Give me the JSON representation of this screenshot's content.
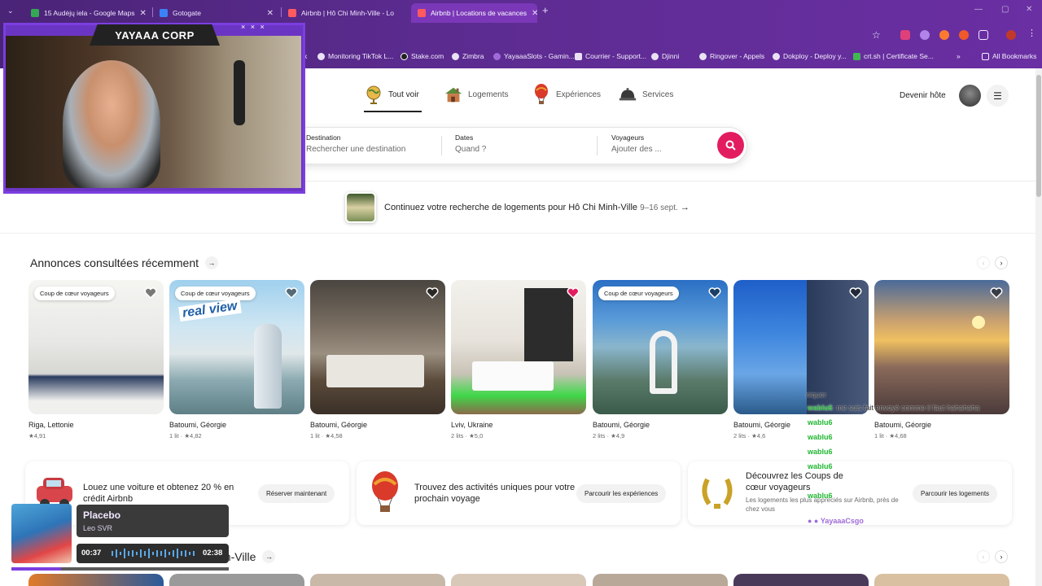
{
  "browser": {
    "tabs": [
      {
        "title": "15 Audėjų iela - Google Maps",
        "active": false
      },
      {
        "title": "Gotogate",
        "active": false
      },
      {
        "title": "Airbnb | Hô Chi Minh-Ville - Lo",
        "active": false
      },
      {
        "title": "Airbnb | Locations de vacances",
        "active": true
      }
    ],
    "bookmarks": [
      {
        "label": "Monitoring TikTok L..."
      },
      {
        "label": "Stake.com"
      },
      {
        "label": "Zimbra"
      },
      {
        "label": "YayaaaSlots - Gamin..."
      },
      {
        "label": "Courrier - Support..."
      },
      {
        "label": "Djinni"
      },
      {
        "label": "Ringover - Appels"
      },
      {
        "label": "Dokploy - Deploy y..."
      },
      {
        "label": "crt.sh | Certificate Se..."
      },
      {
        "label": "All Bookmarks"
      }
    ],
    "bookmarks_prefix": "k",
    "bookmarks_more": "»"
  },
  "header": {
    "categories": [
      {
        "label": "Tout voir",
        "icon": "globe-icon",
        "selected": true
      },
      {
        "label": "Logements",
        "icon": "house-icon",
        "selected": false
      },
      {
        "label": "Expériences",
        "icon": "balloon-icon",
        "selected": false
      },
      {
        "label": "Services",
        "icon": "bell-icon",
        "selected": false
      }
    ],
    "host_label": "Devenir hôte"
  },
  "search": {
    "destination": {
      "label": "Destination",
      "placeholder": "Rechercher une destination"
    },
    "dates": {
      "label": "Dates",
      "placeholder": "Quand ?"
    },
    "guests": {
      "label": "Voyageurs",
      "placeholder": "Ajouter des ..."
    }
  },
  "continue_search": {
    "text": "Continuez votre recherche de logements pour Hô Chi Minh-Ville",
    "dates": "9–16 sept.",
    "arrow": "→"
  },
  "recent": {
    "title": "Annonces consultées récemment",
    "arrow": "→",
    "listings": [
      {
        "badge": "Coup de cœur voyageurs",
        "location": "Riga, Lettonie",
        "meta": "★4,91",
        "favorited": false
      },
      {
        "badge": "Coup de cœur voyageurs",
        "location": "Batoumi, Géorgie",
        "meta": "1 lit · ★4,82",
        "favorited": false,
        "overlay_text": "real view"
      },
      {
        "badge": "",
        "location": "Batoumi, Géorgie",
        "meta": "1 lit · ★4,58",
        "favorited": false
      },
      {
        "badge": "",
        "location": "Lviv, Ukraine",
        "meta": "2 lits · ★5,0",
        "favorited": true
      },
      {
        "badge": "Coup de cœur voyageurs",
        "location": "Batoumi, Géorgie",
        "meta": "2 lits · ★4,9",
        "favorited": false
      },
      {
        "badge": "",
        "location": "Batoumi, Géorgie",
        "meta": "2 lits · ★4,6",
        "favorited": false
      },
      {
        "badge": "",
        "location": "Batoumi, Géorgie",
        "meta": "1 lit · ★4,68",
        "favorited": false
      }
    ]
  },
  "promos": [
    {
      "text": "Louez une voiture et obtenez 20 % en crédit Airbnb",
      "button": "Réserver maintenant"
    },
    {
      "text": "Trouvez des activités uniques pour votre prochain voyage",
      "button": "Parcourir les expériences"
    },
    {
      "text": "Découvrez les Coups de cœur voyageurs",
      "subtext": "Les logements les plus appréciés sur Airbnb, près de chez vous",
      "button": "Parcourir les logements"
    }
  ],
  "section2": {
    "title": "nh-Ville",
    "arrow": "→"
  },
  "stream": {
    "cam_title": "YAYAAA CORP",
    "cam_deco": "× × ×",
    "music": {
      "title": "Placebo",
      "artist": "Leo SVR",
      "current": "00:37",
      "total": "02:38",
      "progress": 0.23
    },
    "chat": [
      {
        "user": "",
        "msg": "niquer"
      },
      {
        "user": "wablu6",
        "msg": ": me suis fait envoyé comme il faut hahahaha"
      },
      {
        "user": "wablu6",
        "msg": ""
      },
      {
        "user": "wablu6",
        "msg": ""
      },
      {
        "user": "wablu6",
        "msg": ""
      },
      {
        "user": "wablu6",
        "msg": ""
      },
      {
        "user": "wablu6",
        "msg": ""
      },
      {
        "user": "YayaaaCsgo",
        "msg": ""
      }
    ]
  },
  "colors": {
    "brand": "#e31c5f",
    "chrome": "#5b2b8f",
    "stream_accent": "#7c3ee0",
    "chat_user": "#1fb830"
  }
}
